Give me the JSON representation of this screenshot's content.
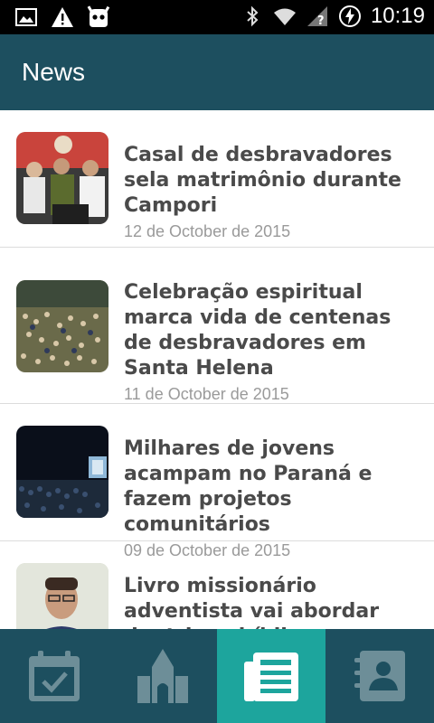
{
  "status_bar": {
    "time": "10:19",
    "left_icons": [
      "image-icon",
      "warning-icon",
      "cyanogen-icon"
    ],
    "right_icons": [
      "bluetooth-icon",
      "wifi-icon",
      "no-signal-icon",
      "battery-charging-icon"
    ]
  },
  "app_bar": {
    "title": "News"
  },
  "news": [
    {
      "title": "Casal de desbravadores sela matrimônio durante Campori",
      "date": "12 de October de 2015",
      "thumb_icon": "wedding-photo"
    },
    {
      "title": "Celebração espiritual marca vida de centenas de desbravadores em Santa Helena",
      "date": "11 de October de 2015",
      "thumb_icon": "crowd-photo"
    },
    {
      "title": "Milhares de jovens acampam no Paraná e fazem projetos comunitários",
      "date": "09 de October de 2015",
      "thumb_icon": "night-stage-photo"
    },
    {
      "title": "Livro missionário adventista vai abordar doutrinas bíblicas controvertidas",
      "date": "",
      "thumb_icon": "portrait-photo"
    }
  ],
  "bottom_nav": {
    "tabs": [
      {
        "icon": "calendar-check-icon",
        "active": false
      },
      {
        "icon": "church-icon",
        "active": false
      },
      {
        "icon": "newspaper-icon",
        "active": true
      },
      {
        "icon": "contacts-icon",
        "active": false
      }
    ]
  },
  "colors": {
    "app_bar": "#1d4f5f",
    "active_tab": "#1da59d",
    "inactive_icon": "#6d8e98",
    "title_text": "#4a4a4a",
    "date_text": "#9a9a9a"
  }
}
